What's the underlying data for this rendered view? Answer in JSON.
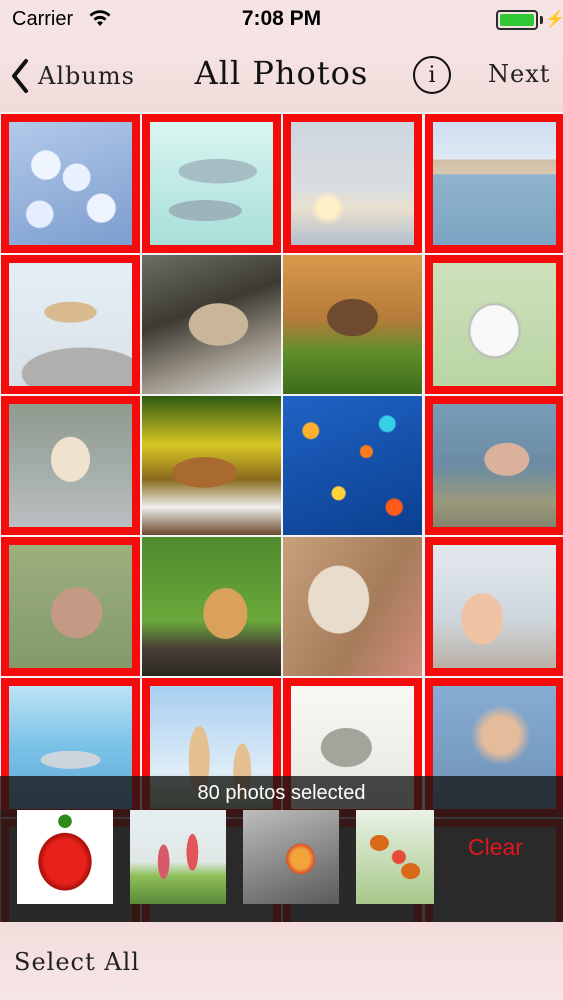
{
  "status_bar": {
    "carrier": "Carrier",
    "time": "7:08 PM"
  },
  "nav": {
    "back_label": "Albums",
    "title": "All Photos",
    "info_label": "i",
    "next_label": "Next"
  },
  "photos": [
    {
      "subject": "jellyfish",
      "selected": true
    },
    {
      "subject": "dolphins underwater",
      "selected": true
    },
    {
      "subject": "dolphins jumping at sunset",
      "selected": true
    },
    {
      "subject": "dolphin near coastal town",
      "selected": true
    },
    {
      "subject": "lioness with cubs",
      "selected": true
    },
    {
      "subject": "lynx on branch",
      "selected": false
    },
    {
      "subject": "running dog",
      "selected": false
    },
    {
      "subject": "husky",
      "selected": true
    },
    {
      "subject": "pug",
      "selected": true
    },
    {
      "subject": "lynx in leaves",
      "selected": false
    },
    {
      "subject": "tropical fish",
      "selected": false
    },
    {
      "subject": "lionfish",
      "selected": true
    },
    {
      "subject": "barking dog",
      "selected": true
    },
    {
      "subject": "cat on grass",
      "selected": false
    },
    {
      "subject": "fluffy cat",
      "selected": false
    },
    {
      "subject": "ginger cat",
      "selected": true
    },
    {
      "subject": "dolphins",
      "selected": true
    },
    {
      "subject": "giraffes",
      "selected": true
    },
    {
      "subject": "dinosaur",
      "selected": true
    },
    {
      "subject": "lionfish",
      "selected": true
    }
  ],
  "selection": {
    "count_text": "80 photos selected",
    "thumbnails": [
      "red pepper",
      "children jumping rope",
      "flower in grayscale",
      "butterflies"
    ],
    "clear_label": "Clear"
  },
  "bottom_bar": {
    "select_all_label": "Select All"
  },
  "colors": {
    "selection_border": "#f40b0b",
    "clear": "#e2171b",
    "battery": "#31c836"
  }
}
